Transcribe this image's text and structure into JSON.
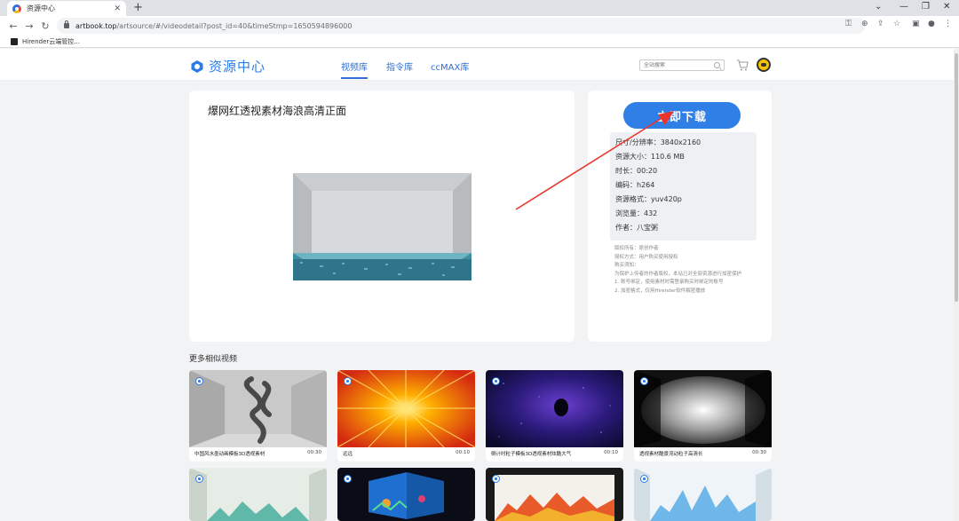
{
  "browser": {
    "tab_title": "资源中心",
    "url_host": "artbook.top",
    "url_path": "/artsource/#/videodetail?post_id=40&timeStmp=1650594896000",
    "bookmark_label": "Hirender云端管控..."
  },
  "header": {
    "logo_text": "资源中心",
    "nav": [
      "视频库",
      "指令库",
      "ccMAX库"
    ],
    "active_nav": "视频库",
    "search_placeholder": "全站搜索"
  },
  "video": {
    "title": "爆网红透视素材海浪高清正面"
  },
  "info": {
    "download_label": "立即下载",
    "specs": [
      "尺寸/分辨率：3840x2160",
      "资源大小：110.6 MB",
      "时长：00:20",
      "编码：h264",
      "资源格式：yuv420p",
      "浏览量：432",
      "作者：八宝粥"
    ],
    "notes": [
      "版权所有：原创作者",
      "授权方式：用户购买使用授权",
      "购买须知：",
      "为保护上传者的作者版权，本站已对全部资源进行加密保护",
      "1. 账号绑定，使用素材时需登录购买时绑定的账号",
      "2. 加密格式，仅用Hirender软件解密播放"
    ]
  },
  "more": {
    "section_title": "更多相似视频",
    "items": [
      {
        "caption": "中国风水墨动画模板3D透视素材",
        "duration": "00:30"
      },
      {
        "caption": "远远",
        "duration": "00:10"
      },
      {
        "caption": "倒计时粒子模板3D透视素材炫酷大气",
        "duration": "00:10"
      },
      {
        "caption": "透视素材酷景流动粒子高清长",
        "duration": "00:30"
      }
    ]
  },
  "colors": {
    "accent": "#2f7fe6",
    "page_bg": "#f2f3f5"
  }
}
